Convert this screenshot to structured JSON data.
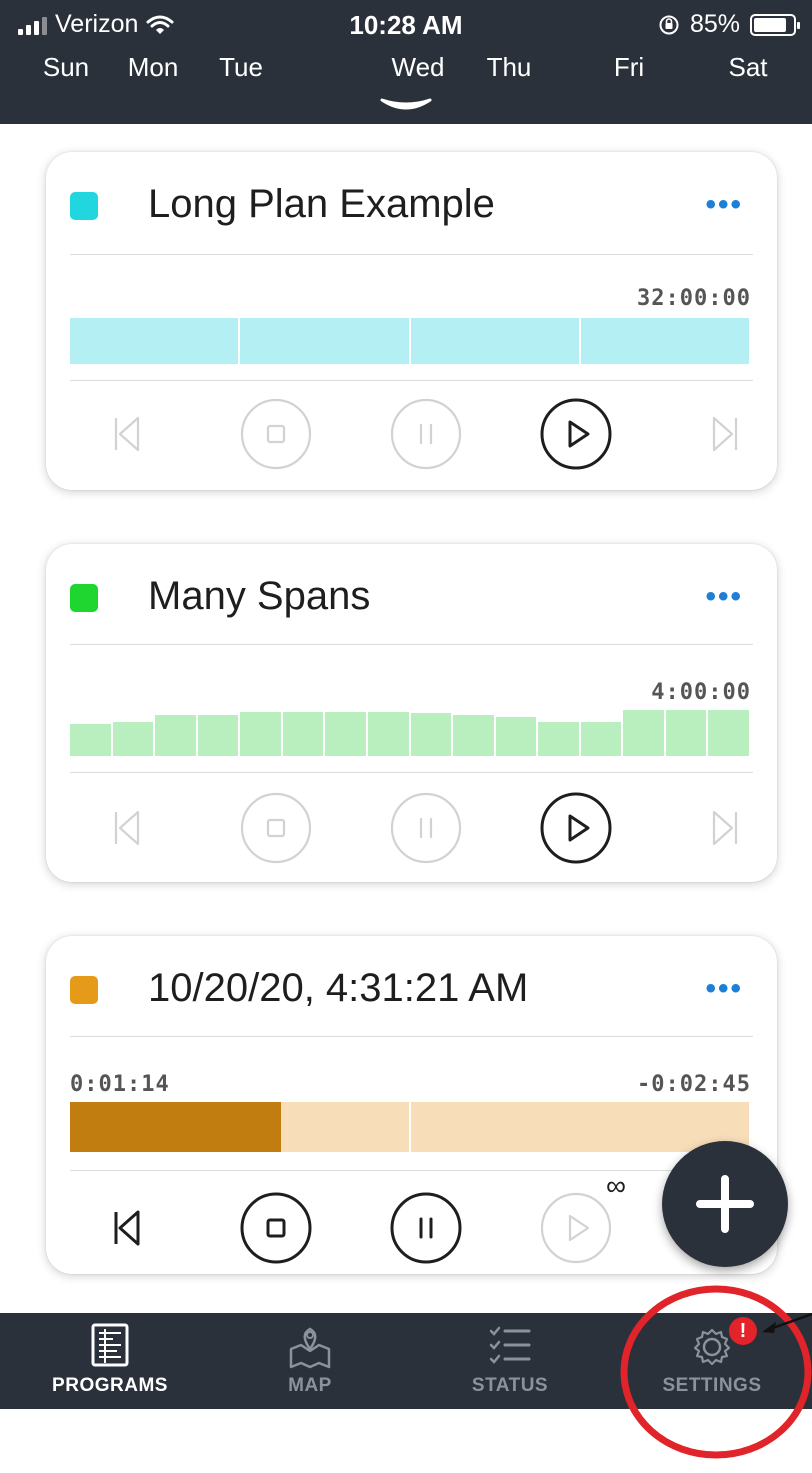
{
  "status_bar": {
    "carrier": "Verizon",
    "time": "10:28 AM",
    "battery": "85%",
    "battery_level": 0.85
  },
  "days": [
    {
      "label": "Sun",
      "selected": false
    },
    {
      "label": "Mon",
      "selected": false
    },
    {
      "label": "Tue",
      "selected": false
    },
    {
      "label": "Wed",
      "selected": true
    },
    {
      "label": "Thu",
      "selected": false
    },
    {
      "label": "Fri",
      "selected": false
    },
    {
      "label": "Sat",
      "selected": false
    }
  ],
  "programs": [
    {
      "title": "Long Plan Example",
      "color": "#22d6df",
      "more": "•••",
      "time_right": "32:00:00",
      "time_left": "",
      "bar_color": "#b3eff3",
      "segments": [
        1,
        1,
        1,
        1
      ],
      "controls": {
        "prev": false,
        "stop": false,
        "pause": false,
        "play": true,
        "next": false
      }
    },
    {
      "title": "Many Spans",
      "color": "#1fd631",
      "more": "•••",
      "time_right": "4:00:00",
      "time_left": "",
      "bar_color": "#b9efbe",
      "segments": [
        0.7,
        0.73,
        0.9,
        0.9,
        0.95,
        0.95,
        0.95,
        0.95,
        0.93,
        0.9,
        0.85,
        0.75,
        0.75,
        1.0,
        1.0,
        1.0
      ],
      "controls": {
        "prev": false,
        "stop": false,
        "pause": false,
        "play": true,
        "next": false
      }
    },
    {
      "title": "10/20/20, 4:31:21 AM",
      "color": "#e69a1a",
      "more": "•••",
      "time_right": "-0:02:45",
      "time_left": "0:01:14",
      "bar_color": "#f7ddb8",
      "progress_color": "#c27d10",
      "progress": 0.31,
      "segments": [
        1,
        1
      ],
      "repeat_symbol": "∞",
      "controls": {
        "prev": true,
        "stop": true,
        "pause": true,
        "play": false,
        "next": true
      }
    }
  ],
  "fab": {
    "icon": "plus-icon"
  },
  "tabs": [
    {
      "label": "PROGRAMS",
      "icon": "programs-icon",
      "active": true
    },
    {
      "label": "MAP",
      "icon": "map-icon",
      "active": false
    },
    {
      "label": "STATUS",
      "icon": "status-list-icon",
      "active": false
    },
    {
      "label": "SETTINGS",
      "icon": "gear-icon",
      "active": false,
      "badge": "!"
    }
  ],
  "colors": {
    "header_bg": "#2b313b",
    "accent_blue": "#1e7fd6",
    "badge_red": "#e4222a",
    "annotation_red": "#e0242a",
    "tab_active": "#ffffff",
    "tab_inactive": "#8b929c"
  }
}
